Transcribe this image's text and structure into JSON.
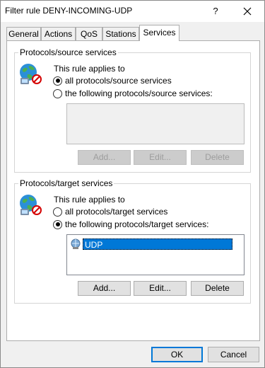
{
  "window": {
    "title": "Filter rule DENY-INCOMING-UDP",
    "help_glyph": "?"
  },
  "tabs": [
    {
      "label": "General"
    },
    {
      "label": "Actions"
    },
    {
      "label": "QoS"
    },
    {
      "label": "Stations"
    },
    {
      "label": "Services"
    }
  ],
  "source": {
    "legend": "Protocols/source services",
    "applies": "This rule applies to",
    "option_all": "all protocols/source services",
    "option_following": "the following protocols/source services:",
    "add": "Add...",
    "edit": "Edit...",
    "delete": "Delete"
  },
  "target": {
    "legend": "Protocols/target services",
    "applies": "This rule applies to",
    "option_all": "all protocols/target services",
    "option_following": "the following protocols/target services:",
    "items": [
      "UDP"
    ],
    "add": "Add...",
    "edit": "Edit...",
    "delete": "Delete"
  },
  "footer": {
    "ok": "OK",
    "cancel": "Cancel"
  }
}
